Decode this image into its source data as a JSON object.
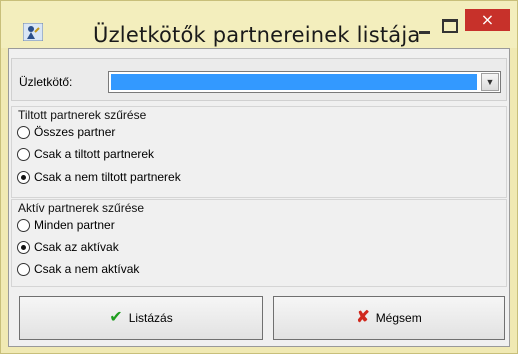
{
  "window": {
    "title": "Üzletkötők partnereinek listája",
    "close_glyph": "×",
    "colors": {
      "titlebar": "#f3eebd",
      "close": "#c7312a",
      "selection": "#3399ff"
    }
  },
  "partner": {
    "label": "Üzletkötő:",
    "selected_value": "",
    "dropdown_icon": "chevron-down-icon"
  },
  "banned_filter": {
    "title": "Tiltott partnerek szűrése",
    "options": [
      "Összes partner",
      "Csak a tiltott partnerek",
      "Csak a nem tiltott partnerek"
    ],
    "selected": 2
  },
  "active_filter": {
    "title": "Aktív partnerek szűrése",
    "options": [
      "Minden partner",
      "Csak az aktívak",
      "Csak a nem aktívak"
    ],
    "selected": 1
  },
  "buttons": {
    "list_label": "Listázás",
    "list_icon": "checkmark-icon",
    "cancel_label": "Mégsem",
    "cancel_icon": "x-icon"
  }
}
